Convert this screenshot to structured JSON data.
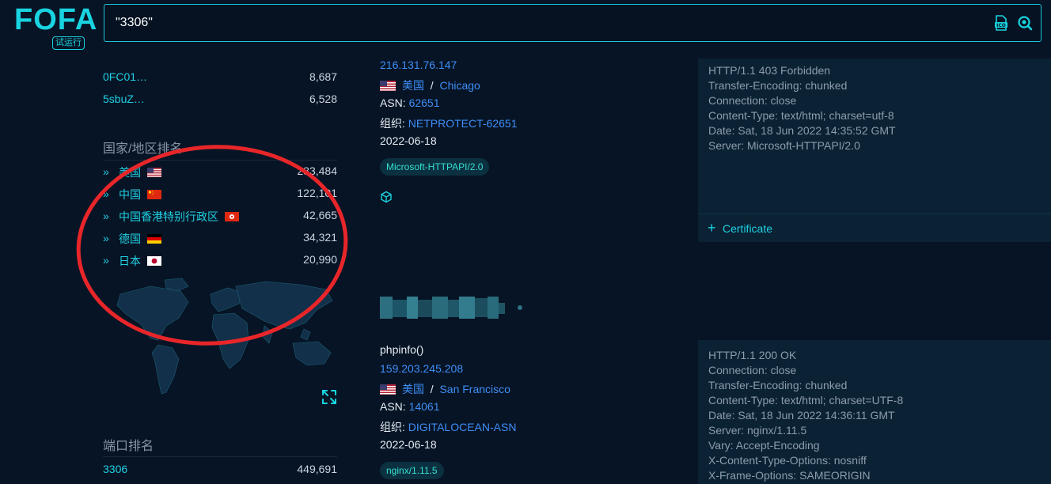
{
  "logo": {
    "text": "FOFA",
    "badge": "试运行"
  },
  "search": {
    "value": "\"3306\"",
    "icons": [
      "ico-icon",
      "search-icon"
    ]
  },
  "sidebar": {
    "top_rows": [
      {
        "name": "0FC01…",
        "count": "8,687"
      },
      {
        "name": "5sbuZ…",
        "count": "6,528"
      }
    ],
    "country_title": "国家/地区排名",
    "countries": [
      {
        "name": "美国",
        "flag": "us",
        "count": "283,484"
      },
      {
        "name": "中国",
        "flag": "cn",
        "count": "122,101"
      },
      {
        "name": "中国香港特别行政区",
        "flag": "hk",
        "count": "42,665"
      },
      {
        "name": "德国",
        "flag": "de",
        "count": "34,321"
      },
      {
        "name": "日本",
        "flag": "jp",
        "count": "20,990"
      }
    ],
    "port_title": "端口排名",
    "ports": [
      {
        "name": "3306",
        "count": "449,691"
      }
    ]
  },
  "results": [
    {
      "title": "",
      "ip": "216.131.76.147",
      "country": "美国",
      "city": "Chicago",
      "asn_label": "ASN:",
      "asn": "62651",
      "org_label": "组织:",
      "org": "NETPROTECT-62651",
      "date": "2022-06-18",
      "tag": "Microsoft-HTTPAPI/2.0",
      "header_lines": [
        "HTTP/1.1 403 Forbidden",
        "Transfer-Encoding: chunked",
        "Connection: close",
        "Content-Type: text/html; charset=utf-8",
        "Date: Sat, 18 Jun 2022 14:35:52 GMT",
        "Server: Microsoft-HTTPAPI/2.0"
      ],
      "cert_label": "Certificate"
    },
    {
      "title": "phpinfo()",
      "ip": "159.203.245.208",
      "country": "美国",
      "city": "San Francisco",
      "asn_label": "ASN:",
      "asn": "14061",
      "org_label": "组织:",
      "org": "DIGITALOCEAN-ASN",
      "date": "2022-06-18",
      "tag": "nginx/1.11.5",
      "header_lines": [
        "HTTP/1.1 200 OK",
        "Connection: close",
        "Transfer-Encoding: chunked",
        "Content-Type: text/html; charset=UTF-8",
        "Date: Sat, 18 Jun 2022 14:36:11 GMT",
        "Server: nginx/1.11.5",
        "Vary: Accept-Encoding",
        "X-Content-Type-Options: nosniff",
        "X-Frame-Options: SAMEORIGIN"
      ]
    }
  ],
  "separator": "/",
  "colors": {
    "accent": "#19d3e0",
    "link": "#3e8ef7",
    "annotation": "#e8262a"
  }
}
